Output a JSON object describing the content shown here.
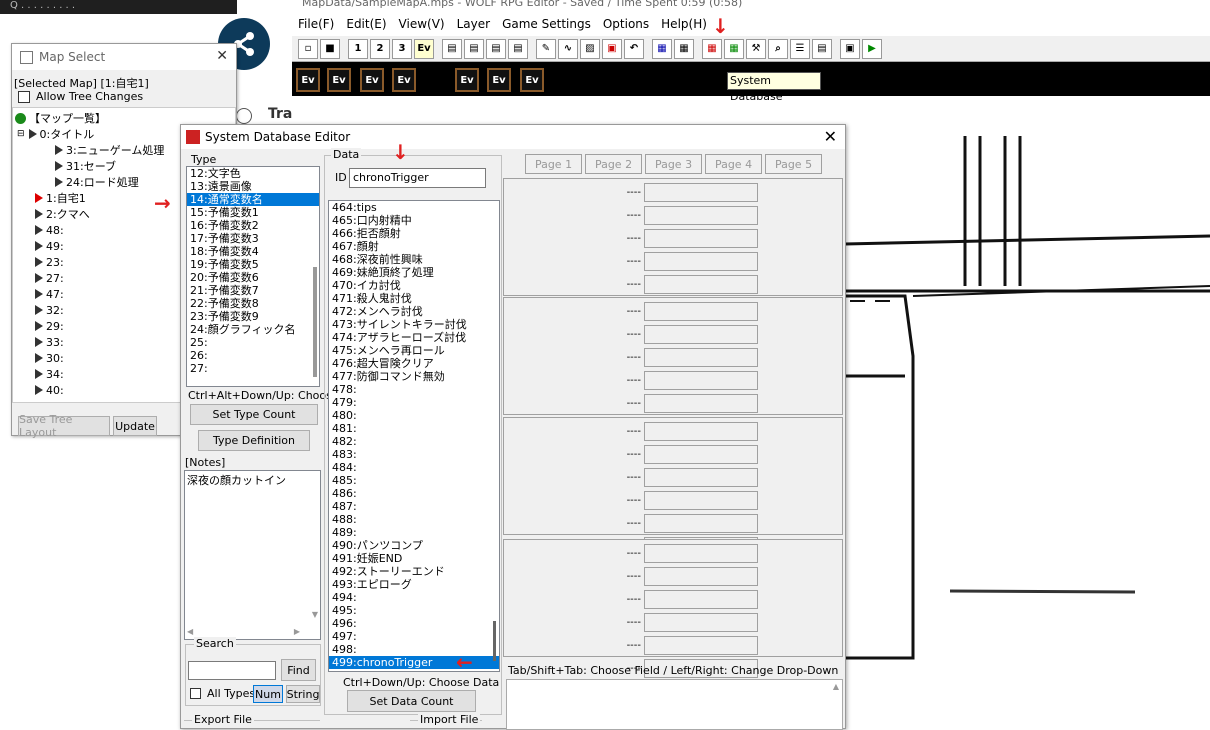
{
  "top_left_bar": "Q  . . .    .   .  .   .  . . ",
  "wolf": {
    "title": "MapData/SampleMapA.mps - WOLF RPG Editor - Saved / Time Spent 0:59 (0:58)",
    "menus": [
      "File(F)",
      "Edit(E)",
      "View(V)",
      "Layer",
      "Game Settings",
      "Options",
      "Help(H)"
    ],
    "tooltip": "System Database",
    "ev_label": "Ev"
  },
  "partial_text": "Tra",
  "map_select": {
    "title": "Map Select",
    "selected_map": "[Selected Map] [1:自宅1]",
    "allow_tree": "Allow Tree Changes",
    "root": "【マップ一覧】",
    "tree": [
      {
        "label": "0:タイトル",
        "level": 1
      },
      {
        "label": "3:ニューゲーム処理",
        "level": 2
      },
      {
        "label": "31:セーブ",
        "level": 2
      },
      {
        "label": "24:ロード処理",
        "level": 2
      },
      {
        "label": "1:自宅1",
        "level": 1
      },
      {
        "label": "2:クマへ",
        "level": 1
      },
      {
        "label": "48:",
        "level": 1
      },
      {
        "label": "49:",
        "level": 1
      },
      {
        "label": "23:",
        "level": 1
      },
      {
        "label": "27:",
        "level": 1
      },
      {
        "label": "47:",
        "level": 1
      },
      {
        "label": "32:",
        "level": 1
      },
      {
        "label": "29:",
        "level": 1
      },
      {
        "label": "33:",
        "level": 1
      },
      {
        "label": "30:",
        "level": 1
      },
      {
        "label": "34:",
        "level": 1
      },
      {
        "label": "40:",
        "level": 1
      }
    ],
    "save_tree": "Save Tree Layout",
    "update": "Update"
  },
  "sysdb": {
    "title": "System Database Editor",
    "type_label": "Type",
    "types": [
      "12:文字色",
      "13:遠景画像",
      "14:通常変数名",
      "15:予備変数1",
      "16:予備変数2",
      "17:予備変数3",
      "18:予備変数4",
      "19:予備変数5",
      "20:予備変数6",
      "21:予備変数7",
      "22:予備変数8",
      "23:予備変数9",
      "24:顔グラフィック名",
      "25:",
      "26:",
      "27:"
    ],
    "type_hint": "Ctrl+Alt+Down/Up: Choose",
    "set_type_count": "Set Type Count",
    "type_definition": "Type Definition",
    "notes_label": "[Notes]",
    "notes": "深夜の顔カットイン",
    "search_label": "Search",
    "find": "Find",
    "all_types": "All Types",
    "num": "Num",
    "string": "String",
    "export_file": "Export File",
    "import_file": "Import File",
    "data_label": "Data",
    "id_label": "ID",
    "id_value": "chronoTrigger",
    "data_items": [
      "464:tips",
      "465:口内射精中",
      "466:拒否顔射",
      "467:顔射",
      "468:深夜前性興味",
      "469:妹絶頂終了処理",
      "470:イカ討伐",
      "471:殺人鬼討伐",
      "472:メンヘラ討伐",
      "473:サイレントキラー討伐",
      "474:アザラヒーローズ討伐",
      "475:メンヘラ再ロール",
      "476:超大冒険クリア",
      "477:防御コマンド無効",
      "478:",
      "479:",
      "480:",
      "481:",
      "482:",
      "483:",
      "484:",
      "485:",
      "486:",
      "487:",
      "488:",
      "489:",
      "490:パンツコンプ",
      "491:妊娠END",
      "492:ストーリーエンド",
      "493:エピローグ",
      "494:",
      "495:",
      "496:",
      "497:",
      "498:",
      "499:chronoTrigger"
    ],
    "data_hint": "Ctrl+Down/Up: Choose Data",
    "set_data_count": "Set Data Count",
    "pages": [
      "Page 1",
      "Page 2",
      "Page 3",
      "Page 4",
      "Page 5"
    ],
    "field_dash": "----",
    "bottom_hint": "Tab/Shift+Tab: Choose Field / Left/Right: Change Drop-Down List"
  }
}
